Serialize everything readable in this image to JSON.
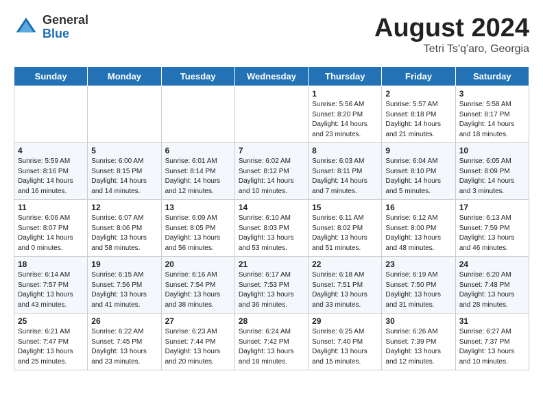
{
  "header": {
    "logo_general": "General",
    "logo_blue": "Blue",
    "title": "August 2024",
    "subtitle": "Tetri Ts'q'aro, Georgia"
  },
  "days_of_week": [
    "Sunday",
    "Monday",
    "Tuesday",
    "Wednesday",
    "Thursday",
    "Friday",
    "Saturday"
  ],
  "weeks": [
    [
      {
        "num": "",
        "sunrise": "",
        "sunset": "",
        "daylight": ""
      },
      {
        "num": "",
        "sunrise": "",
        "sunset": "",
        "daylight": ""
      },
      {
        "num": "",
        "sunrise": "",
        "sunset": "",
        "daylight": ""
      },
      {
        "num": "",
        "sunrise": "",
        "sunset": "",
        "daylight": ""
      },
      {
        "num": "1",
        "sunrise": "Sunrise: 5:56 AM",
        "sunset": "Sunset: 8:20 PM",
        "daylight": "Daylight: 14 hours and 23 minutes."
      },
      {
        "num": "2",
        "sunrise": "Sunrise: 5:57 AM",
        "sunset": "Sunset: 8:18 PM",
        "daylight": "Daylight: 14 hours and 21 minutes."
      },
      {
        "num": "3",
        "sunrise": "Sunrise: 5:58 AM",
        "sunset": "Sunset: 8:17 PM",
        "daylight": "Daylight: 14 hours and 18 minutes."
      }
    ],
    [
      {
        "num": "4",
        "sunrise": "Sunrise: 5:59 AM",
        "sunset": "Sunset: 8:16 PM",
        "daylight": "Daylight: 14 hours and 16 minutes."
      },
      {
        "num": "5",
        "sunrise": "Sunrise: 6:00 AM",
        "sunset": "Sunset: 8:15 PM",
        "daylight": "Daylight: 14 hours and 14 minutes."
      },
      {
        "num": "6",
        "sunrise": "Sunrise: 6:01 AM",
        "sunset": "Sunset: 8:14 PM",
        "daylight": "Daylight: 14 hours and 12 minutes."
      },
      {
        "num": "7",
        "sunrise": "Sunrise: 6:02 AM",
        "sunset": "Sunset: 8:12 PM",
        "daylight": "Daylight: 14 hours and 10 minutes."
      },
      {
        "num": "8",
        "sunrise": "Sunrise: 6:03 AM",
        "sunset": "Sunset: 8:11 PM",
        "daylight": "Daylight: 14 hours and 7 minutes."
      },
      {
        "num": "9",
        "sunrise": "Sunrise: 6:04 AM",
        "sunset": "Sunset: 8:10 PM",
        "daylight": "Daylight: 14 hours and 5 minutes."
      },
      {
        "num": "10",
        "sunrise": "Sunrise: 6:05 AM",
        "sunset": "Sunset: 8:09 PM",
        "daylight": "Daylight: 14 hours and 3 minutes."
      }
    ],
    [
      {
        "num": "11",
        "sunrise": "Sunrise: 6:06 AM",
        "sunset": "Sunset: 8:07 PM",
        "daylight": "Daylight: 14 hours and 0 minutes."
      },
      {
        "num": "12",
        "sunrise": "Sunrise: 6:07 AM",
        "sunset": "Sunset: 8:06 PM",
        "daylight": "Daylight: 13 hours and 58 minutes."
      },
      {
        "num": "13",
        "sunrise": "Sunrise: 6:09 AM",
        "sunset": "Sunset: 8:05 PM",
        "daylight": "Daylight: 13 hours and 56 minutes."
      },
      {
        "num": "14",
        "sunrise": "Sunrise: 6:10 AM",
        "sunset": "Sunset: 8:03 PM",
        "daylight": "Daylight: 13 hours and 53 minutes."
      },
      {
        "num": "15",
        "sunrise": "Sunrise: 6:11 AM",
        "sunset": "Sunset: 8:02 PM",
        "daylight": "Daylight: 13 hours and 51 minutes."
      },
      {
        "num": "16",
        "sunrise": "Sunrise: 6:12 AM",
        "sunset": "Sunset: 8:00 PM",
        "daylight": "Daylight: 13 hours and 48 minutes."
      },
      {
        "num": "17",
        "sunrise": "Sunrise: 6:13 AM",
        "sunset": "Sunset: 7:59 PM",
        "daylight": "Daylight: 13 hours and 46 minutes."
      }
    ],
    [
      {
        "num": "18",
        "sunrise": "Sunrise: 6:14 AM",
        "sunset": "Sunset: 7:57 PM",
        "daylight": "Daylight: 13 hours and 43 minutes."
      },
      {
        "num": "19",
        "sunrise": "Sunrise: 6:15 AM",
        "sunset": "Sunset: 7:56 PM",
        "daylight": "Daylight: 13 hours and 41 minutes."
      },
      {
        "num": "20",
        "sunrise": "Sunrise: 6:16 AM",
        "sunset": "Sunset: 7:54 PM",
        "daylight": "Daylight: 13 hours and 38 minutes."
      },
      {
        "num": "21",
        "sunrise": "Sunrise: 6:17 AM",
        "sunset": "Sunset: 7:53 PM",
        "daylight": "Daylight: 13 hours and 36 minutes."
      },
      {
        "num": "22",
        "sunrise": "Sunrise: 6:18 AM",
        "sunset": "Sunset: 7:51 PM",
        "daylight": "Daylight: 13 hours and 33 minutes."
      },
      {
        "num": "23",
        "sunrise": "Sunrise: 6:19 AM",
        "sunset": "Sunset: 7:50 PM",
        "daylight": "Daylight: 13 hours and 31 minutes."
      },
      {
        "num": "24",
        "sunrise": "Sunrise: 6:20 AM",
        "sunset": "Sunset: 7:48 PM",
        "daylight": "Daylight: 13 hours and 28 minutes."
      }
    ],
    [
      {
        "num": "25",
        "sunrise": "Sunrise: 6:21 AM",
        "sunset": "Sunset: 7:47 PM",
        "daylight": "Daylight: 13 hours and 25 minutes."
      },
      {
        "num": "26",
        "sunrise": "Sunrise: 6:22 AM",
        "sunset": "Sunset: 7:45 PM",
        "daylight": "Daylight: 13 hours and 23 minutes."
      },
      {
        "num": "27",
        "sunrise": "Sunrise: 6:23 AM",
        "sunset": "Sunset: 7:44 PM",
        "daylight": "Daylight: 13 hours and 20 minutes."
      },
      {
        "num": "28",
        "sunrise": "Sunrise: 6:24 AM",
        "sunset": "Sunset: 7:42 PM",
        "daylight": "Daylight: 13 hours and 18 minutes."
      },
      {
        "num": "29",
        "sunrise": "Sunrise: 6:25 AM",
        "sunset": "Sunset: 7:40 PM",
        "daylight": "Daylight: 13 hours and 15 minutes."
      },
      {
        "num": "30",
        "sunrise": "Sunrise: 6:26 AM",
        "sunset": "Sunset: 7:39 PM",
        "daylight": "Daylight: 13 hours and 12 minutes."
      },
      {
        "num": "31",
        "sunrise": "Sunrise: 6:27 AM",
        "sunset": "Sunset: 7:37 PM",
        "daylight": "Daylight: 13 hours and 10 minutes."
      }
    ]
  ]
}
